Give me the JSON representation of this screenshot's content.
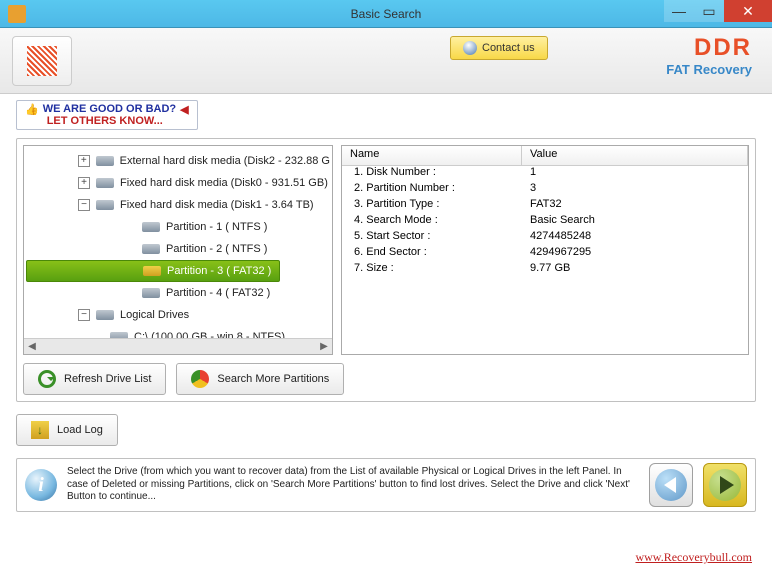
{
  "window": {
    "title": "Basic Search"
  },
  "header": {
    "contact": "Contact us",
    "brand_main": "DDR",
    "brand_sub": "FAT Recovery"
  },
  "slogan": {
    "line1": "WE ARE GOOD OR BAD?",
    "line2": "LET OTHERS KNOW..."
  },
  "tree": {
    "items": [
      {
        "level": 0,
        "exp": "+",
        "icon": "drive",
        "label": "External hard disk media (Disk2 - 232.88 G"
      },
      {
        "level": 0,
        "exp": "+",
        "icon": "drive",
        "label": "Fixed hard disk media (Disk0 - 931.51 GB)"
      },
      {
        "level": 0,
        "exp": "−",
        "icon": "drive",
        "label": "Fixed hard disk media (Disk1 - 3.64 TB)"
      },
      {
        "level": 2,
        "exp": "",
        "icon": "drive",
        "label": "Partition - 1 ( NTFS )"
      },
      {
        "level": 2,
        "exp": "",
        "icon": "drive",
        "label": "Partition - 2 ( NTFS )"
      },
      {
        "level": 2,
        "exp": "",
        "icon": "ydrive",
        "label": "Partition - 3 ( FAT32 )",
        "selected": true
      },
      {
        "level": 2,
        "exp": "",
        "icon": "drive",
        "label": "Partition - 4 ( FAT32 )"
      },
      {
        "level": 0,
        "exp": "−",
        "icon": "drive",
        "label": "Logical Drives"
      },
      {
        "level": 1,
        "exp": "",
        "icon": "drive",
        "label": "C:\\ (100.00 GB - win 8 - NTFS)"
      }
    ]
  },
  "table": {
    "col_name": "Name",
    "col_value": "Value",
    "rows": [
      {
        "name": "1. Disk Number :",
        "value": "1"
      },
      {
        "name": "2. Partition Number :",
        "value": "3"
      },
      {
        "name": "3. Partition Type :",
        "value": "FAT32"
      },
      {
        "name": "4. Search Mode :",
        "value": "Basic Search"
      },
      {
        "name": "5. Start Sector :",
        "value": "4274485248"
      },
      {
        "name": "6. End Sector :",
        "value": "4294967295"
      },
      {
        "name": "7. Size :",
        "value": "9.77 GB"
      }
    ]
  },
  "buttons": {
    "refresh": "Refresh Drive List",
    "search_more": "Search More Partitions",
    "load_log": "Load Log"
  },
  "footer": {
    "text": "Select the Drive (from which you want to recover data) from the List of available Physical or Logical Drives in the left Panel. In case of Deleted or missing Partitions, click on 'Search More Partitions' button to find lost drives. Select the Drive and click 'Next' Button to continue..."
  },
  "watermark": "www.Recoverybull.com"
}
